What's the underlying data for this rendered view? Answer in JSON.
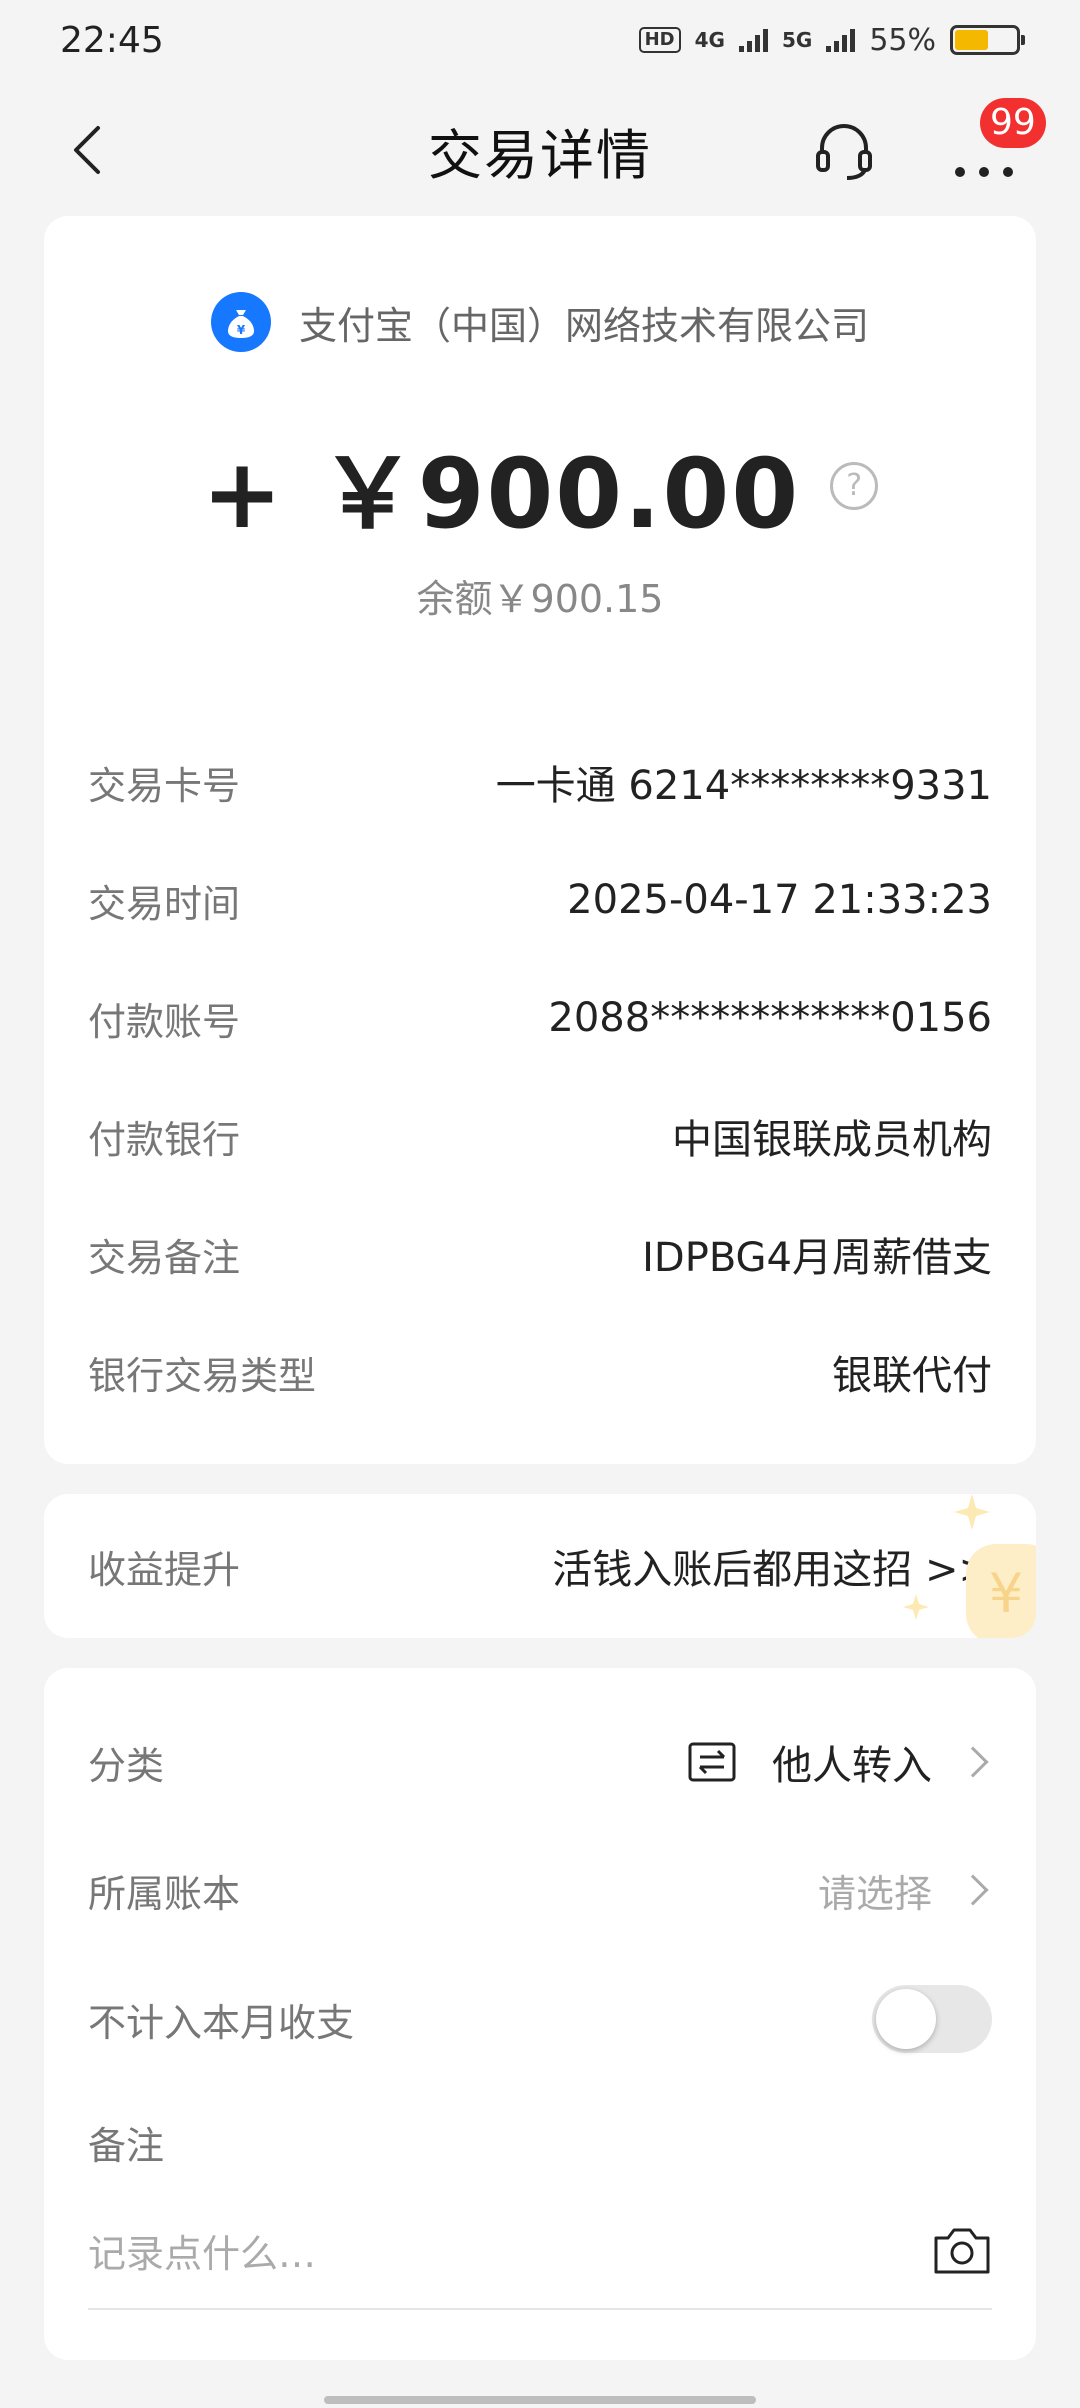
{
  "status": {
    "time": "22:45",
    "hd": "HD",
    "net1": "4G",
    "net2": "5G",
    "battery": "55%",
    "battery_level": 0.55
  },
  "nav": {
    "title": "交易详情",
    "badge": "99"
  },
  "transaction": {
    "merchant": "支付宝（中国）网络技术有限公司",
    "amount": "+ ￥900.00",
    "balance": "余额￥900.15",
    "rows": [
      {
        "label": "交易卡号",
        "value": "一卡通 6214********9331"
      },
      {
        "label": "交易时间",
        "value": "2025-04-17 21:33:23"
      },
      {
        "label": "付款账号",
        "value": "2088************0156"
      },
      {
        "label": "付款银行",
        "value": "中国银联成员机构"
      },
      {
        "label": "交易备注",
        "value": "IDPBG4月周薪借支"
      },
      {
        "label": "银行交易类型",
        "value": "银联代付"
      }
    ]
  },
  "promo": {
    "label": "收益提升",
    "link": "活钱入账后都用这招 >>"
  },
  "settings": {
    "category_label": "分类",
    "category_value": "他人转入",
    "ledger_label": "所属账本",
    "ledger_value": "请选择",
    "exclude_label": "不计入本月收支",
    "exclude_on": false,
    "note_label": "备注",
    "note_placeholder": "记录点什么…"
  }
}
